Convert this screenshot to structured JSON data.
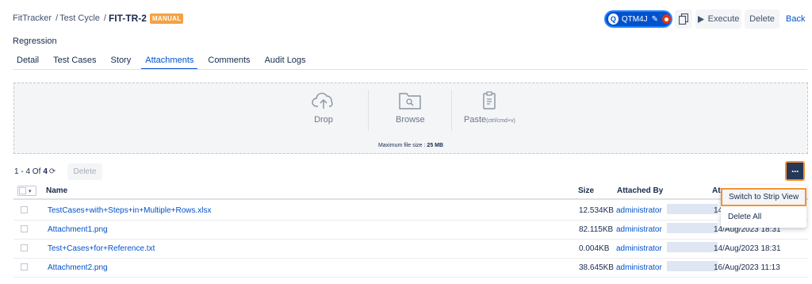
{
  "breadcrumb": {
    "project": "FitTracker",
    "sep1": "/",
    "section": "Test Cycle",
    "sep2": "/",
    "current": "FIT-TR-2",
    "badge": "MANUAL"
  },
  "header": {
    "qtm_label": "QTM4J",
    "qtm_logo": "Q",
    "execute_label": "Execute",
    "delete_label": "Delete",
    "back_label": "Back"
  },
  "title": "Regression",
  "tabs": [
    {
      "label": "Detail"
    },
    {
      "label": "Test Cases"
    },
    {
      "label": "Story"
    },
    {
      "label": "Attachments",
      "active": true
    },
    {
      "label": "Comments"
    },
    {
      "label": "Audit Logs"
    }
  ],
  "dropzone": {
    "drop_label": "Drop",
    "browse_label": "Browse",
    "paste_label": "Paste",
    "paste_hint": "(ctrl/cmd+v)",
    "max_prefix": "Maximum file size :",
    "max_value": "25 MB"
  },
  "toolbar": {
    "range": "1 - 4 Of",
    "total": "4",
    "delete_label": "Delete",
    "more_label": "···"
  },
  "table": {
    "headers": {
      "name": "Name",
      "size": "Size",
      "attached_by": "Attached By",
      "attached_on": "At"
    },
    "rows": [
      {
        "name": "TestCases+with+Steps+in+Multiple+Rows.xlsx",
        "size": "12.534KB",
        "by": "administrator",
        "date": "14/"
      },
      {
        "name": "Attachment1.png",
        "size": "82.115KB",
        "by": "administrator",
        "date": "14/Aug/2023 18:31"
      },
      {
        "name": "Test+Cases+for+Reference.txt",
        "size": "0.004KB",
        "by": "administrator",
        "date": "14/Aug/2023 18:31"
      },
      {
        "name": "Attachment2.png",
        "size": "38.645KB",
        "by": "administrator",
        "date": "16/Aug/2023 11:13"
      }
    ]
  },
  "menu": {
    "switch_label": "Switch to Strip View",
    "delete_all_label": "Delete All"
  },
  "colors": {
    "primary": "#0052cc",
    "highlight": "#f79232",
    "badge": "#f4a244"
  }
}
